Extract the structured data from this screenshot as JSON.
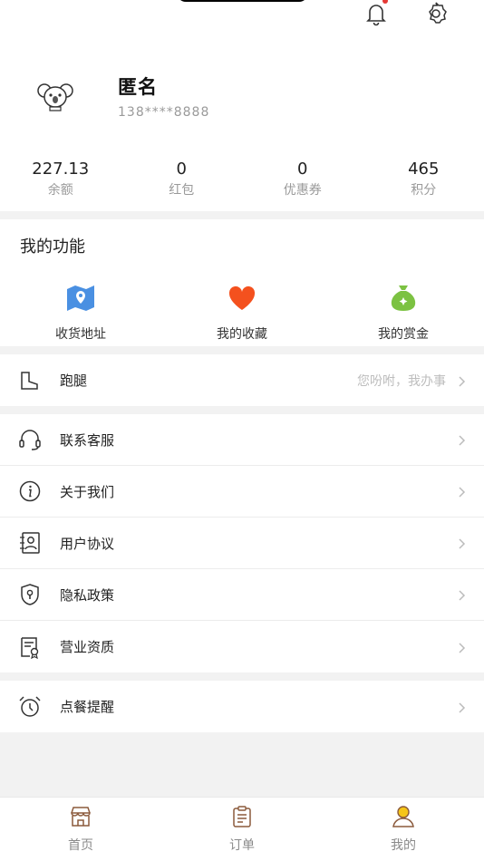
{
  "header": {
    "has_notification": true
  },
  "profile": {
    "name": "匿名",
    "phone": "138****8888"
  },
  "stats": [
    {
      "value": "227.13",
      "label": "余额"
    },
    {
      "value": "0",
      "label": "红包"
    },
    {
      "value": "0",
      "label": "优惠券"
    },
    {
      "value": "465",
      "label": "积分"
    }
  ],
  "functions": {
    "title": "我的功能",
    "items": [
      {
        "label": "收货地址",
        "icon": "map-icon"
      },
      {
        "label": "我的收藏",
        "icon": "heart-icon"
      },
      {
        "label": "我的赏金",
        "icon": "money-bag-icon"
      }
    ]
  },
  "errand": {
    "label": "跑腿",
    "hint": "您吩咐，我办事",
    "icon": "boot-icon"
  },
  "menu": [
    {
      "label": "联系客服",
      "icon": "headset-icon"
    },
    {
      "label": "关于我们",
      "icon": "info-icon"
    },
    {
      "label": "用户协议",
      "icon": "user-doc-icon"
    },
    {
      "label": "隐私政策",
      "icon": "shield-lock-icon"
    },
    {
      "label": "营业资质",
      "icon": "certificate-icon"
    }
  ],
  "reminder": {
    "label": "点餐提醒",
    "icon": "alarm-clock-icon"
  },
  "tabs": [
    {
      "label": "首页",
      "icon": "shop-icon",
      "active": false
    },
    {
      "label": "订单",
      "icon": "clipboard-icon",
      "active": false
    },
    {
      "label": "我的",
      "icon": "person-icon",
      "active": true
    }
  ],
  "colors": {
    "accent": "#f5c518",
    "heart": "#f4511e",
    "map": "#4a90e2",
    "bag": "#7cc242",
    "tab_icon": "#8b5a3c"
  }
}
